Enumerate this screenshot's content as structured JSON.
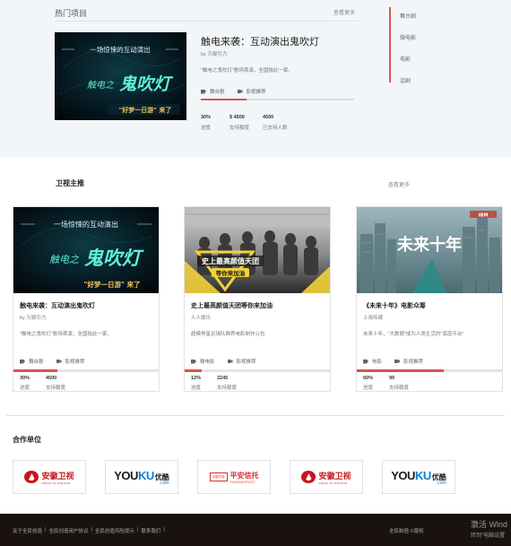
{
  "hot": {
    "title": "热门项目",
    "more": "查看更多",
    "project": {
      "title": "触电来袭：互动演出鬼吹灯",
      "org": "by 万娱引力",
      "desc": "\"触电之鬼吹灯\"剧场首演，全国独此一家。",
      "tag1": "舞台剧",
      "tag2": "影视推荐",
      "progress_percent": 30,
      "stats": [
        {
          "value": "30%",
          "label": "进度"
        },
        {
          "value": "$ 4500",
          "label": "支持额度"
        },
        {
          "value": "4500",
          "label": "已支持人数"
        }
      ],
      "poster": {
        "line1": "一场惊悚的互动演出",
        "brand": "触电之",
        "main": "鬼吹灯",
        "slogan": "\"好梦一日游\" 来了"
      }
    },
    "side_nav": [
      "舞台剧",
      "微电影",
      "电影",
      "话剧"
    ]
  },
  "recommend": {
    "title": "卫视主推",
    "more": "查看更多",
    "cards": [
      {
        "title": "触电来袭：互动演出鬼吹灯",
        "org": "by 万娱引力",
        "desc": "\"触电之鬼吹灯\"剧场首演，全国独此一家。",
        "tag1": "舞台剧",
        "tag2": "影视推荐",
        "progress_percent": 30,
        "stats": [
          {
            "value": "30%",
            "label": "进度"
          },
          {
            "value": "4500",
            "label": "支持额度"
          }
        ],
        "poster": {
          "line1": "一场惊悚的互动演出",
          "brand": "触电之",
          "main": "鬼吹灯",
          "slogan": "\"好梦一日游\" 来了"
        }
      },
      {
        "title": "史上最高颜值天团等你来加油",
        "org": "人人娱乐",
        "desc": "超模男星足球队跨界电影制作公告",
        "tag1": "微电影",
        "tag2": "影视推荐",
        "progress_percent": 12,
        "stats": [
          {
            "value": "12%",
            "label": "进度"
          },
          {
            "value": "2245",
            "label": "支持额度"
          }
        ],
        "poster": {
          "small": "JUST FOR YOU",
          "main": "史上最高颜值天团",
          "sub": "等你来加油"
        }
      },
      {
        "title": "《未来十年》电影众筹",
        "org": "上海传媒",
        "desc": "未来十年，\"大数据\"成为人类生活的\"底层平台\"",
        "tag1": "电影",
        "tag2": "影视推荐",
        "progress_percent": 60,
        "stats": [
          {
            "value": "60%",
            "label": "进度"
          },
          {
            "value": "99",
            "label": "支持额度"
          }
        ],
        "poster": {
          "main": "未来十年",
          "corner": "IBM"
        }
      }
    ]
  },
  "partners": {
    "title": "合作单位",
    "items": [
      {
        "type": "anhui",
        "name": "安徽卫视",
        "sub": "ANHUI TV STATION"
      },
      {
        "type": "youku",
        "you": "YOU",
        "ku": "KU",
        "cn": "优酷",
        "com": ".com"
      },
      {
        "type": "pingan",
        "box": "中国平安",
        "name": "平安信托",
        "sub": "PINGANTRUST"
      },
      {
        "type": "anhui",
        "name": "安徽卫视",
        "sub": "ANHUI TV STATION"
      },
      {
        "type": "youku",
        "you": "YOU",
        "ku": "KU",
        "cn": "优酷",
        "com": ".com"
      }
    ]
  },
  "footer": {
    "links": [
      "关于全民创造",
      "|",
      "全民创造用户协议",
      "|",
      "全民创造风险提示",
      "|",
      "联系我们",
      "|"
    ],
    "right": "全民制造 ©版权",
    "watermark": "激活 Wind",
    "watermark_sub": "转到\"电脑设置"
  },
  "colors": {
    "accent": "#d9534f",
    "bg_light": "#f3f6f8",
    "footer": "#1a1210"
  }
}
